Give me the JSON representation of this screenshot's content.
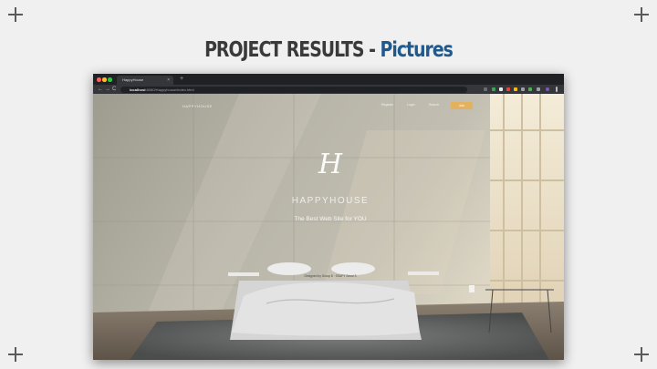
{
  "slide": {
    "title_prefix": "PROJECT RESULTS - ",
    "title_highlight": "Pictures"
  },
  "browser": {
    "tab_title": "HappyHouse",
    "tab_close": "×",
    "new_tab": "+",
    "nav_back": "←",
    "nav_forward": "→",
    "nav_reload": "C",
    "address_host": "localhost",
    "address_path": ":8080/Happyhouse/index.html"
  },
  "website": {
    "logo_text": "HAPPYHOUSE",
    "nav": [
      "Register",
      "Login",
      "Search"
    ],
    "cta_label": "Join",
    "hero_mark": "H",
    "hero_title": "HAPPYHOUSE",
    "hero_subtitle": "The Best Web Site for YOU",
    "credit": "Designed by Group 8 · SSAFY Seoul 3"
  },
  "colors": {
    "title_dark": "#3a3a3a",
    "title_blue": "#1f5a8f",
    "cta": "#e4b15e"
  }
}
